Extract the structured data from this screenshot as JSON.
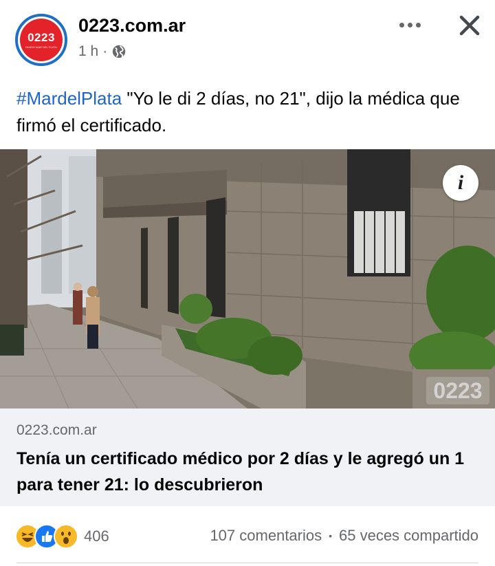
{
  "post": {
    "page_name": "0223.com.ar",
    "avatar_text": "0223",
    "avatar_tagline": "DIARIO MAR DEL PLATA",
    "time": "1 h",
    "separator": "·",
    "hashtag": "#MardelPlata",
    "text": " \"Yo le di 2 días, no 21\", dijo la médica que firmó el certificado."
  },
  "link": {
    "domain": "0223.com.ar",
    "title": "Tenía un certificado médico por 2 días y le agregó un 1 para tener 21: lo descubrieron",
    "watermark": "0223"
  },
  "footer": {
    "reaction_count": "406",
    "comments": "107 comentarios",
    "dot": "•",
    "shares": "65 veces compartido"
  },
  "icons": {
    "more": "more-icon",
    "close": "close-icon",
    "globe": "globe-icon",
    "info": "info-icon"
  },
  "colors": {
    "brand_red": "#e3222a",
    "avatar_ring": "#1f6fc4",
    "hashtag": "#1e65c9",
    "link_bg": "#f0f2f5"
  }
}
